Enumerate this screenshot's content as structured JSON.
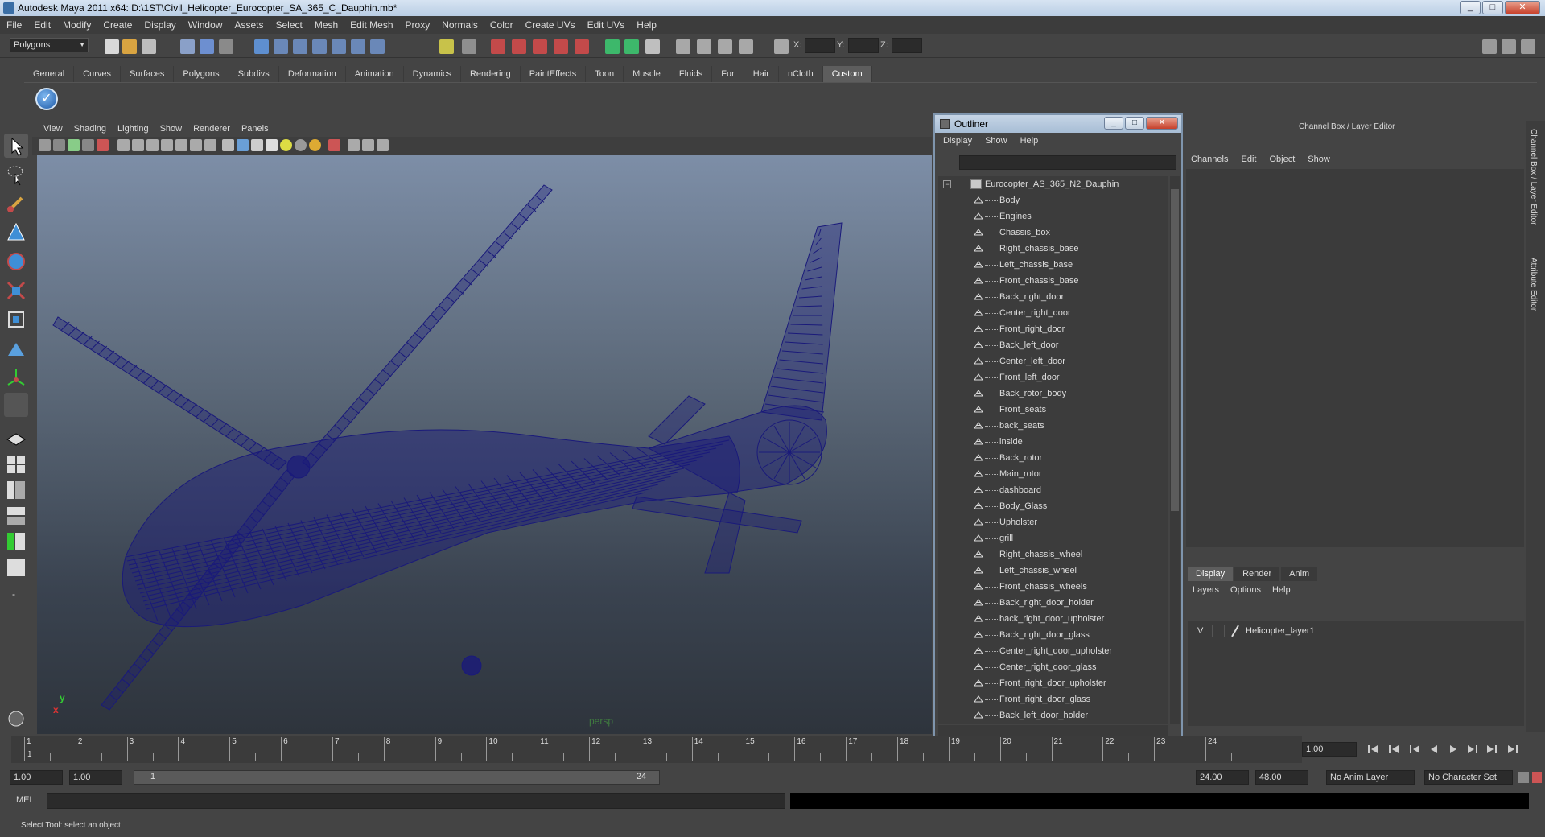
{
  "title": "Autodesk Maya 2011 x64: D:\\1ST\\Civil_Helicopter_Eurocopter_SA_365_C_Dauphin.mb*",
  "window_buttons": {
    "minimize": "_",
    "maximize": "□",
    "close": "✕"
  },
  "menubar": [
    "File",
    "Edit",
    "Modify",
    "Create",
    "Display",
    "Window",
    "Assets",
    "Select",
    "Mesh",
    "Edit Mesh",
    "Proxy",
    "Normals",
    "Color",
    "Create UVs",
    "Edit UVs",
    "Help"
  ],
  "statusline": {
    "mode": "Polygons",
    "x_label": "X:",
    "y_label": "Y:",
    "z_label": "Z:"
  },
  "shelf_tabs": [
    "General",
    "Curves",
    "Surfaces",
    "Polygons",
    "Subdivs",
    "Deformation",
    "Animation",
    "Dynamics",
    "Rendering",
    "PaintEffects",
    "Toon",
    "Muscle",
    "Fluids",
    "Fur",
    "Hair",
    "nCloth",
    "Custom"
  ],
  "shelf_active": "Custom",
  "viewport": {
    "menu": [
      "View",
      "Shading",
      "Lighting",
      "Show",
      "Renderer",
      "Panels"
    ],
    "camera_label": "persp",
    "axis_x": "x",
    "axis_y": "y",
    "wire_color": "#1a1a7a"
  },
  "outliner": {
    "title": "Outliner",
    "menu": [
      "Display",
      "Show",
      "Help"
    ],
    "root": "Eurocopter_AS_365_N2_Dauphin",
    "items": [
      "Body",
      "Engines",
      "Chassis_box",
      "Right_chassis_base",
      "Left_chassis_base",
      "Front_chassis_base",
      "Back_right_door",
      "Center_right_door",
      "Front_right_door",
      "Back_left_door",
      "Center_left_door",
      "Front_left_door",
      "Back_rotor_body",
      "Front_seats",
      "back_seats",
      "inside",
      "Back_rotor",
      "Main_rotor",
      "dashboard",
      "Body_Glass",
      "Upholster",
      "grill",
      "Right_chassis_wheel",
      "Left_chassis_wheel",
      "Front_chassis_wheels",
      "Back_right_door_holder",
      "back_right_door_upholster",
      "Back_right_door_glass",
      "Center_right_door_upholster",
      "Center_right_door_glass",
      "Front_right_door_upholster",
      "Front_right_door_glass",
      "Back_left_door_holder"
    ]
  },
  "channelbox": {
    "title": "Channel Box / Layer Editor",
    "menu": [
      "Channels",
      "Edit",
      "Object",
      "Show"
    ],
    "tabs": [
      "Display",
      "Render",
      "Anim"
    ],
    "active_tab": "Display",
    "layer_menu": [
      "Layers",
      "Options",
      "Help"
    ],
    "layer": {
      "visible": "V",
      "name": "Helicopter_layer1"
    }
  },
  "side_tabs": [
    "Channel Box / Layer Editor",
    "Attribute Editor"
  ],
  "timeline": {
    "ticks": [
      "1",
      "2",
      "3",
      "4",
      "5",
      "6",
      "7",
      "8",
      "9",
      "10",
      "11",
      "12",
      "13",
      "14",
      "15",
      "16",
      "17",
      "18",
      "19",
      "20",
      "21",
      "22",
      "23",
      "24"
    ],
    "current_frame_marker": "1",
    "current_frame": "1.00"
  },
  "range": {
    "start": "1.00",
    "playback_start": "1.00",
    "bar_start": "1",
    "bar_end": "24",
    "playback_end": "24.00",
    "end": "48.00",
    "anim_layer": "No Anim Layer",
    "character_set": "No Character Set"
  },
  "cmdline": {
    "label": "MEL"
  },
  "helpline": "Select Tool: select an object"
}
